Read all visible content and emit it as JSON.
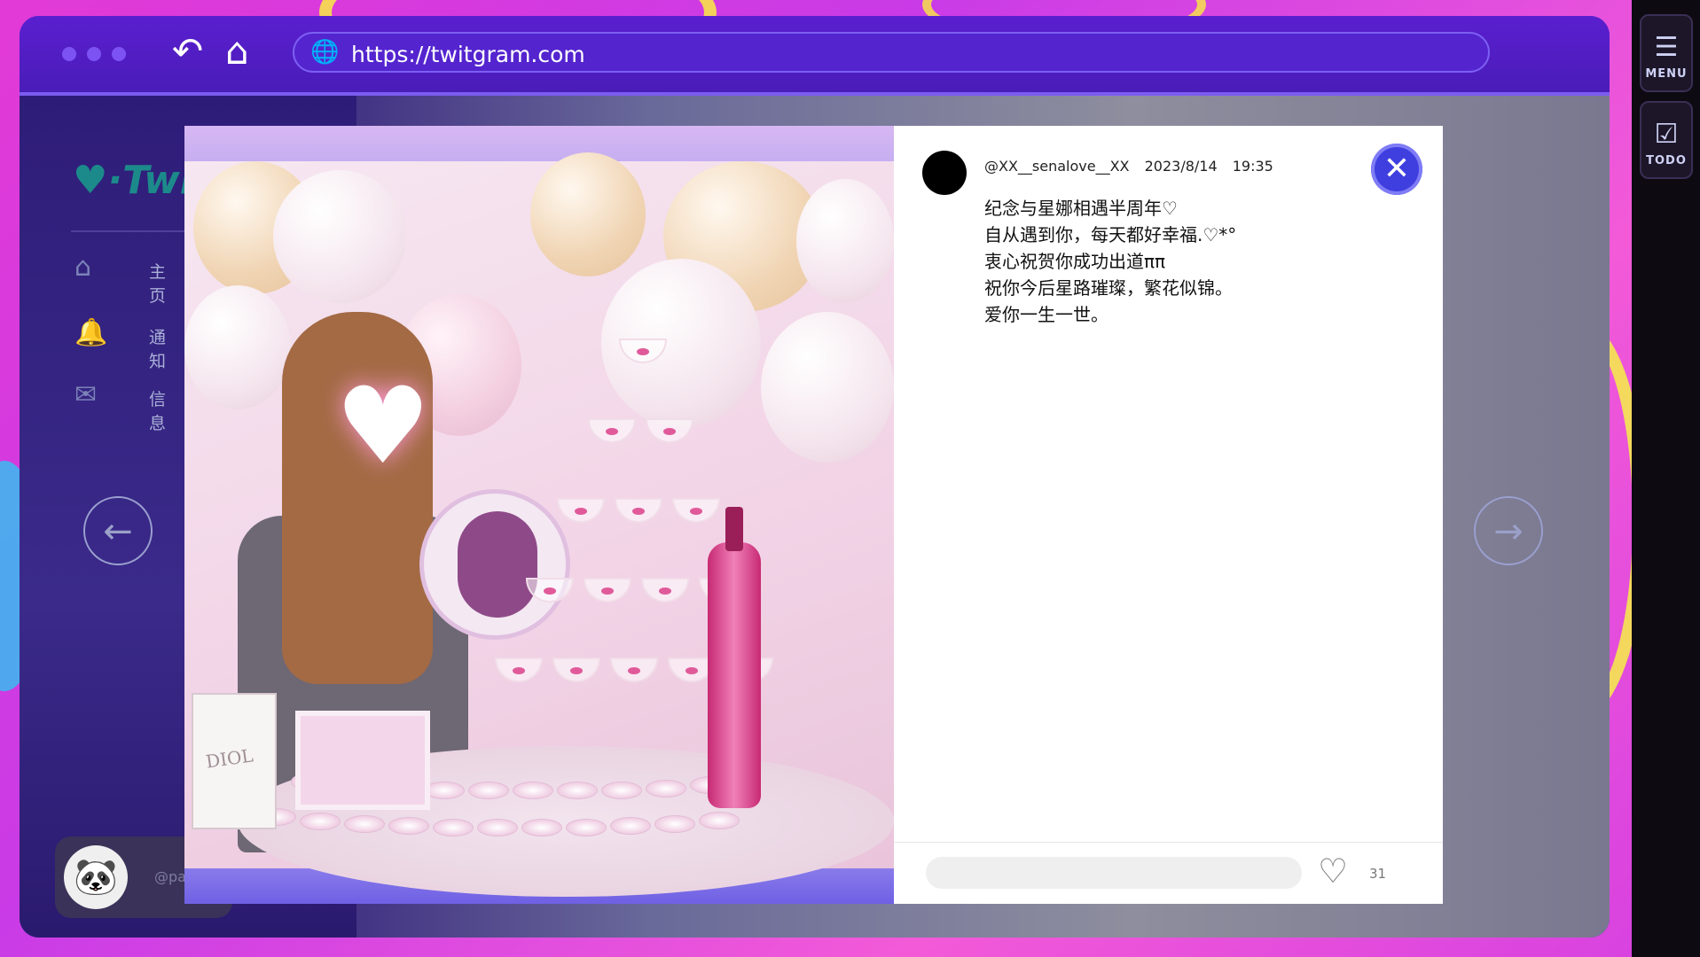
{
  "browser": {
    "url": "https://twitgram.com",
    "back_icon": "back-arrow-icon",
    "home_icon": "home-icon"
  },
  "rail": {
    "menu_label": "MENU",
    "todo_label": "TODO"
  },
  "sidebar": {
    "logo_text": "Twi",
    "items": [
      {
        "label": "主页",
        "icon": "home-outline-icon"
      },
      {
        "label": "通知",
        "icon": "bell-icon"
      },
      {
        "label": "信息",
        "icon": "mail-icon"
      }
    ],
    "me_handle": "@pan_"
  },
  "post": {
    "handle": "@XX__senalove__XX",
    "date": "2023/8/14",
    "time": "19:35",
    "lines": [
      "纪念与星娜相遇半周年♡",
      "自从遇到你，每天都好幸福.♡*°",
      "衷心祝贺你成功出道ππ",
      "祝你今后星路璀璨，繁花似锦。",
      "爱你一生一世。"
    ],
    "likes": "31",
    "image_bag_text": "DIOL"
  },
  "colors": {
    "titlebar": "#5a1fd0",
    "close_button": "#3f3fe0",
    "accent": "#7b5cf0"
  }
}
